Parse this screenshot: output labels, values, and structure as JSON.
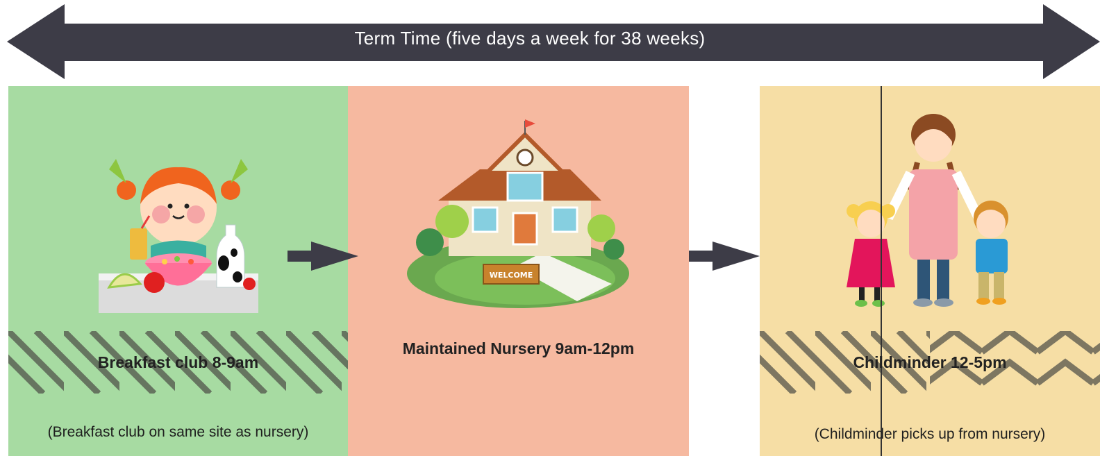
{
  "timeline": {
    "label": "Term Time (five days a week for 38 weeks)"
  },
  "panels": {
    "breakfast": {
      "title": "Breakfast club 8-9am",
      "note": "(Breakfast club on same site as nursery)",
      "illustration": "girl-eating-breakfast-illustration",
      "color": "#a7dba2"
    },
    "nursery": {
      "title": "Maintained Nursery 9am-12pm",
      "illustration": "school-building-illustration",
      "sign": "WELCOME",
      "color": "#f6b9a0"
    },
    "childminder": {
      "title": "Childminder 12-5pm",
      "note": "(Childminder picks up from nursery)",
      "illustration": "childminder-with-children-illustration",
      "color": "#f6dea5"
    }
  },
  "colors": {
    "arrow": "#3d3c47"
  }
}
